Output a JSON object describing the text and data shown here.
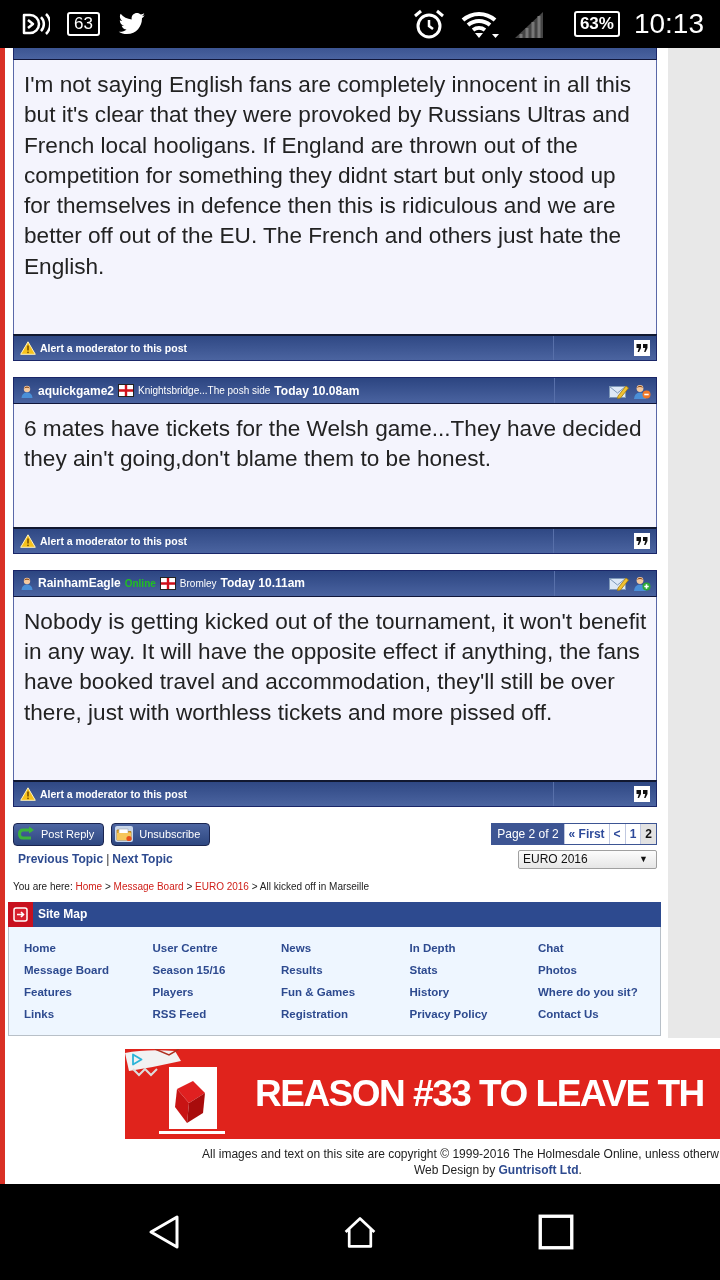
{
  "status_bar": {
    "notification_count": "63",
    "battery": "63%",
    "time": "10:13"
  },
  "posts": [
    {
      "body": "I'm not saying English fans are completely innocent in all this but it's clear that they were provoked by Russians Ultras and French local hooligans. If England are thrown out of the competition for something they didnt start but only stood up for themselves in defence then this is ridiculous and we are better off out of the EU. The French and others just hate the English.",
      "alert": "Alert a moderator to this post"
    },
    {
      "author": "aquickgame2",
      "location": "Knightsbridge...The posh side",
      "time": "Today 10.08am",
      "in_buddy_list": true,
      "body": "6 mates have tickets for the Welsh game...They have decided they ain't going,don't blame them to be honest.",
      "alert": "Alert a moderator to this post"
    },
    {
      "author": "RainhamEagle",
      "status": "Online",
      "location": "Bromley",
      "time": "Today 10.11am",
      "in_buddy_list": false,
      "body": "Nobody is getting kicked out of the tournament, it won't benefit in any way. It will have the opposite effect if anything, the fans have booked travel and accommodation, they'll still be over there, just with worthless tickets and more pissed off.",
      "alert": "Alert a moderator to this post"
    }
  ],
  "actions": [
    {
      "kind": "reply",
      "label": "Post Reply"
    },
    {
      "kind": "unsubscribe",
      "label": "Unsubscribe"
    }
  ],
  "pagination": {
    "label": "Page 2 of 2",
    "items": [
      {
        "text": "« First",
        "selected": false
      },
      {
        "text": "<",
        "selected": false
      },
      {
        "text": "1",
        "selected": false
      },
      {
        "text": "2",
        "selected": true
      }
    ]
  },
  "topic_nav": {
    "previous": "Previous Topic",
    "separator": "|",
    "next": "Next Topic"
  },
  "forum_select": {
    "value": "EURO 2016",
    "arrow": "▼"
  },
  "breadcrumb": [
    {
      "kind": "text",
      "text": "You are here:"
    },
    {
      "kind": "link",
      "text": "Home"
    },
    {
      "kind": "text",
      "text": ">"
    },
    {
      "kind": "link",
      "text": "Message Board"
    },
    {
      "kind": "text",
      "text": ">"
    },
    {
      "kind": "link",
      "text": "EURO 2016"
    },
    {
      "kind": "text",
      "text": ">"
    },
    {
      "kind": "text",
      "text": "All kicked off in Marseille"
    }
  ],
  "site_map": {
    "title": "Site Map",
    "links": [
      "Home",
      "User Centre",
      "News",
      "In Depth",
      "Chat",
      "Message Board",
      "Season 15/16",
      "Results",
      "Stats",
      "Photos",
      "Features",
      "Players",
      "Fun & Games",
      "History",
      "Where do you sit?",
      "Links",
      "RSS Feed",
      "Registration",
      "Privacy Policy",
      "Contact Us"
    ]
  },
  "ad": {
    "headline": "REASON #33 TO LEAVE TH"
  },
  "footer": {
    "copyright": "All images and text on this site are copyright © 1999-2016 The Holmesdale Online, unless otherw",
    "credit": "Web Design by",
    "credit_link": "Guntrisoft Ltd",
    "credit_end": "."
  }
}
